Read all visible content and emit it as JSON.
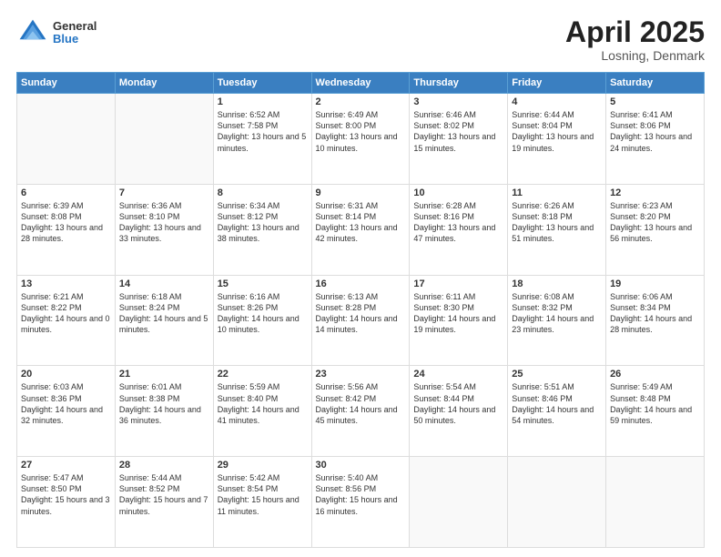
{
  "header": {
    "logo": {
      "general": "General",
      "blue": "Blue"
    },
    "title": "April 2025",
    "subtitle": "Losning, Denmark"
  },
  "calendar": {
    "weekdays": [
      "Sunday",
      "Monday",
      "Tuesday",
      "Wednesday",
      "Thursday",
      "Friday",
      "Saturday"
    ],
    "rows": [
      [
        {
          "day": "",
          "info": ""
        },
        {
          "day": "",
          "info": ""
        },
        {
          "day": "1",
          "info": "Sunrise: 6:52 AM\nSunset: 7:58 PM\nDaylight: 13 hours\nand 5 minutes."
        },
        {
          "day": "2",
          "info": "Sunrise: 6:49 AM\nSunset: 8:00 PM\nDaylight: 13 hours\nand 10 minutes."
        },
        {
          "day": "3",
          "info": "Sunrise: 6:46 AM\nSunset: 8:02 PM\nDaylight: 13 hours\nand 15 minutes."
        },
        {
          "day": "4",
          "info": "Sunrise: 6:44 AM\nSunset: 8:04 PM\nDaylight: 13 hours\nand 19 minutes."
        },
        {
          "day": "5",
          "info": "Sunrise: 6:41 AM\nSunset: 8:06 PM\nDaylight: 13 hours\nand 24 minutes."
        }
      ],
      [
        {
          "day": "6",
          "info": "Sunrise: 6:39 AM\nSunset: 8:08 PM\nDaylight: 13 hours\nand 28 minutes."
        },
        {
          "day": "7",
          "info": "Sunrise: 6:36 AM\nSunset: 8:10 PM\nDaylight: 13 hours\nand 33 minutes."
        },
        {
          "day": "8",
          "info": "Sunrise: 6:34 AM\nSunset: 8:12 PM\nDaylight: 13 hours\nand 38 minutes."
        },
        {
          "day": "9",
          "info": "Sunrise: 6:31 AM\nSunset: 8:14 PM\nDaylight: 13 hours\nand 42 minutes."
        },
        {
          "day": "10",
          "info": "Sunrise: 6:28 AM\nSunset: 8:16 PM\nDaylight: 13 hours\nand 47 minutes."
        },
        {
          "day": "11",
          "info": "Sunrise: 6:26 AM\nSunset: 8:18 PM\nDaylight: 13 hours\nand 51 minutes."
        },
        {
          "day": "12",
          "info": "Sunrise: 6:23 AM\nSunset: 8:20 PM\nDaylight: 13 hours\nand 56 minutes."
        }
      ],
      [
        {
          "day": "13",
          "info": "Sunrise: 6:21 AM\nSunset: 8:22 PM\nDaylight: 14 hours\nand 0 minutes."
        },
        {
          "day": "14",
          "info": "Sunrise: 6:18 AM\nSunset: 8:24 PM\nDaylight: 14 hours\nand 5 minutes."
        },
        {
          "day": "15",
          "info": "Sunrise: 6:16 AM\nSunset: 8:26 PM\nDaylight: 14 hours\nand 10 minutes."
        },
        {
          "day": "16",
          "info": "Sunrise: 6:13 AM\nSunset: 8:28 PM\nDaylight: 14 hours\nand 14 minutes."
        },
        {
          "day": "17",
          "info": "Sunrise: 6:11 AM\nSunset: 8:30 PM\nDaylight: 14 hours\nand 19 minutes."
        },
        {
          "day": "18",
          "info": "Sunrise: 6:08 AM\nSunset: 8:32 PM\nDaylight: 14 hours\nand 23 minutes."
        },
        {
          "day": "19",
          "info": "Sunrise: 6:06 AM\nSunset: 8:34 PM\nDaylight: 14 hours\nand 28 minutes."
        }
      ],
      [
        {
          "day": "20",
          "info": "Sunrise: 6:03 AM\nSunset: 8:36 PM\nDaylight: 14 hours\nand 32 minutes."
        },
        {
          "day": "21",
          "info": "Sunrise: 6:01 AM\nSunset: 8:38 PM\nDaylight: 14 hours\nand 36 minutes."
        },
        {
          "day": "22",
          "info": "Sunrise: 5:59 AM\nSunset: 8:40 PM\nDaylight: 14 hours\nand 41 minutes."
        },
        {
          "day": "23",
          "info": "Sunrise: 5:56 AM\nSunset: 8:42 PM\nDaylight: 14 hours\nand 45 minutes."
        },
        {
          "day": "24",
          "info": "Sunrise: 5:54 AM\nSunset: 8:44 PM\nDaylight: 14 hours\nand 50 minutes."
        },
        {
          "day": "25",
          "info": "Sunrise: 5:51 AM\nSunset: 8:46 PM\nDaylight: 14 hours\nand 54 minutes."
        },
        {
          "day": "26",
          "info": "Sunrise: 5:49 AM\nSunset: 8:48 PM\nDaylight: 14 hours\nand 59 minutes."
        }
      ],
      [
        {
          "day": "27",
          "info": "Sunrise: 5:47 AM\nSunset: 8:50 PM\nDaylight: 15 hours\nand 3 minutes."
        },
        {
          "day": "28",
          "info": "Sunrise: 5:44 AM\nSunset: 8:52 PM\nDaylight: 15 hours\nand 7 minutes."
        },
        {
          "day": "29",
          "info": "Sunrise: 5:42 AM\nSunset: 8:54 PM\nDaylight: 15 hours\nand 11 minutes."
        },
        {
          "day": "30",
          "info": "Sunrise: 5:40 AM\nSunset: 8:56 PM\nDaylight: 15 hours\nand 16 minutes."
        },
        {
          "day": "",
          "info": ""
        },
        {
          "day": "",
          "info": ""
        },
        {
          "day": "",
          "info": ""
        }
      ]
    ]
  }
}
